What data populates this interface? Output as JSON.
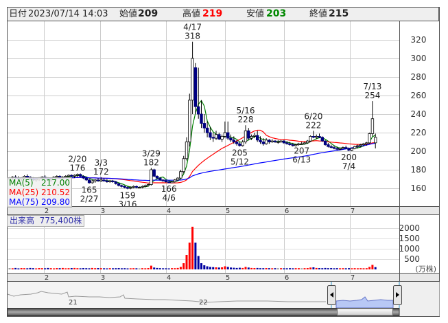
{
  "header": {
    "date_label": "日付",
    "datetime": "2023/07/14 14:03",
    "open_label": "始値",
    "open": "209",
    "high_label": "高値",
    "high": "219",
    "low_label": "安値",
    "low": "203",
    "close_label": "終値",
    "close": "215"
  },
  "colors": {
    "up_volume": "#ff0000",
    "down_volume": "#0000a0",
    "flat_volume": "#909090",
    "down_candle": "#000080",
    "ma5": "#008000",
    "ma25": "#ff0000",
    "ma75": "#0000ff",
    "high_text": "#ff0000",
    "low_text": "#008000"
  },
  "legend": {
    "ma5_label": "MA(5)",
    "ma5_value": "217.00",
    "ma25_label": "MA(25)",
    "ma25_value": "210.52",
    "ma75_label": "MA(75)",
    "ma75_value": "209.80"
  },
  "volume_panel": {
    "label": "出来高",
    "value": "775,400株",
    "unit": "(万株)"
  },
  "navigator": {
    "labels": [
      "21",
      "22"
    ]
  },
  "chart_data": {
    "type": "candlestick",
    "y_ticks": [
      160,
      180,
      200,
      220,
      240,
      260,
      280,
      300,
      320
    ],
    "ylim": [
      150,
      330
    ],
    "month_labels": [
      "2",
      "3",
      "4",
      "5",
      "6",
      "7"
    ],
    "month_start_index": [
      10,
      31,
      53,
      73,
      93,
      115
    ],
    "ohlc": [
      [
        170,
        172,
        168,
        171
      ],
      [
        171,
        173,
        169,
        172
      ],
      [
        172,
        174,
        170,
        171
      ],
      [
        171,
        173,
        169,
        170
      ],
      [
        170,
        172,
        168,
        171
      ],
      [
        171,
        174,
        170,
        173
      ],
      [
        173,
        175,
        171,
        172
      ],
      [
        172,
        173,
        169,
        170
      ],
      [
        170,
        172,
        168,
        169
      ],
      [
        169,
        171,
        167,
        170
      ],
      [
        170,
        172,
        168,
        171
      ],
      [
        171,
        173,
        169,
        172
      ],
      [
        172,
        174,
        170,
        171
      ],
      [
        171,
        172,
        168,
        169
      ],
      [
        169,
        171,
        167,
        170
      ],
      [
        170,
        173,
        169,
        172
      ],
      [
        172,
        174,
        171,
        173
      ],
      [
        173,
        174,
        170,
        171
      ],
      [
        171,
        173,
        170,
        172
      ],
      [
        172,
        174,
        171,
        173
      ],
      [
        173,
        175,
        172,
        174
      ],
      [
        174,
        175,
        172,
        173
      ],
      [
        173,
        175,
        171,
        174
      ],
      [
        174,
        176,
        172,
        175
      ],
      [
        175,
        176,
        172,
        173
      ],
      [
        173,
        174,
        170,
        171
      ],
      [
        171,
        172,
        168,
        169
      ],
      [
        169,
        170,
        165,
        166
      ],
      [
        166,
        169,
        165,
        168
      ],
      [
        168,
        170,
        166,
        169
      ],
      [
        169,
        171,
        167,
        168
      ],
      [
        168,
        172,
        167,
        169
      ],
      [
        169,
        171,
        167,
        168
      ],
      [
        168,
        170,
        166,
        167
      ],
      [
        167,
        169,
        166,
        168
      ],
      [
        168,
        169,
        166,
        167
      ],
      [
        167,
        168,
        164,
        165
      ],
      [
        165,
        166,
        162,
        163
      ],
      [
        163,
        164,
        161,
        162
      ],
      [
        162,
        163,
        160,
        161
      ],
      [
        161,
        162,
        159,
        160
      ],
      [
        160,
        162,
        159,
        161
      ],
      [
        161,
        163,
        160,
        162
      ],
      [
        162,
        163,
        160,
        161
      ],
      [
        161,
        162,
        160,
        161
      ],
      [
        161,
        163,
        160,
        162
      ],
      [
        162,
        164,
        161,
        163
      ],
      [
        163,
        165,
        162,
        164
      ],
      [
        164,
        182,
        163,
        180
      ],
      [
        180,
        181,
        172,
        173
      ],
      [
        173,
        174,
        170,
        171
      ],
      [
        171,
        172,
        168,
        169
      ],
      [
        169,
        170,
        167,
        168
      ],
      [
        168,
        169,
        166,
        167
      ],
      [
        167,
        168,
        166,
        166
      ],
      [
        166,
        168,
        166,
        167
      ],
      [
        167,
        170,
        166,
        169
      ],
      [
        169,
        172,
        168,
        171
      ],
      [
        171,
        180,
        170,
        178
      ],
      [
        178,
        195,
        176,
        192
      ],
      [
        192,
        215,
        190,
        210
      ],
      [
        210,
        262,
        205,
        255
      ],
      [
        255,
        318,
        240,
        300
      ],
      [
        290,
        295,
        240,
        248
      ],
      [
        248,
        290,
        235,
        240
      ],
      [
        240,
        255,
        225,
        230
      ],
      [
        230,
        240,
        220,
        225
      ],
      [
        225,
        232,
        215,
        220
      ],
      [
        220,
        226,
        212,
        215
      ],
      [
        215,
        220,
        210,
        214
      ],
      [
        214,
        222,
        212,
        218
      ],
      [
        218,
        220,
        212,
        213
      ],
      [
        213,
        218,
        210,
        216
      ],
      [
        216,
        232,
        214,
        220
      ],
      [
        220,
        232,
        212,
        214
      ],
      [
        214,
        218,
        210,
        212
      ],
      [
        212,
        216,
        208,
        210
      ],
      [
        210,
        212,
        206,
        208
      ],
      [
        208,
        210,
        205,
        206
      ],
      [
        206,
        212,
        205,
        210
      ],
      [
        210,
        228,
        208,
        222
      ],
      [
        222,
        225,
        212,
        214
      ],
      [
        214,
        218,
        212,
        216
      ],
      [
        216,
        220,
        214,
        217
      ],
      [
        217,
        222,
        210,
        212
      ],
      [
        212,
        216,
        208,
        210
      ],
      [
        210,
        214,
        206,
        208
      ],
      [
        208,
        214,
        207,
        212
      ],
      [
        212,
        213,
        208,
        210
      ],
      [
        210,
        213,
        209,
        211
      ],
      [
        211,
        212,
        209,
        210
      ],
      [
        210,
        212,
        208,
        210
      ],
      [
        210,
        212,
        209,
        211
      ],
      [
        211,
        212,
        208,
        209
      ],
      [
        209,
        211,
        207,
        208
      ],
      [
        208,
        210,
        206,
        207
      ],
      [
        207,
        209,
        205,
        206
      ],
      [
        206,
        208,
        205,
        207
      ],
      [
        207,
        209,
        206,
        208
      ],
      [
        208,
        210,
        207,
        208
      ],
      [
        208,
        210,
        207,
        209
      ],
      [
        209,
        212,
        208,
        211
      ],
      [
        211,
        217,
        210,
        216
      ],
      [
        216,
        222,
        214,
        215
      ],
      [
        215,
        218,
        213,
        216
      ],
      [
        216,
        219,
        214,
        215
      ],
      [
        215,
        216,
        210,
        211
      ],
      [
        211,
        212,
        206,
        207
      ],
      [
        207,
        209,
        204,
        205
      ],
      [
        205,
        207,
        203,
        204
      ],
      [
        204,
        206,
        202,
        203
      ],
      [
        203,
        205,
        201,
        202
      ],
      [
        202,
        204,
        201,
        203
      ],
      [
        203,
        205,
        202,
        204
      ],
      [
        204,
        206,
        202,
        203
      ],
      [
        203,
        204,
        200,
        201
      ],
      [
        201,
        204,
        200,
        203
      ],
      [
        203,
        206,
        202,
        205
      ],
      [
        205,
        207,
        203,
        206
      ],
      [
        206,
        208,
        204,
        207
      ],
      [
        207,
        209,
        205,
        208
      ],
      [
        208,
        210,
        206,
        209
      ],
      [
        209,
        220,
        208,
        219
      ],
      [
        219,
        254,
        216,
        235
      ],
      [
        209,
        219,
        203,
        215
      ]
    ],
    "volume": [
      60,
      55,
      70,
      50,
      65,
      60,
      55,
      70,
      60,
      50,
      65,
      60,
      55,
      70,
      60,
      50,
      65,
      60,
      70,
      55,
      60,
      65,
      70,
      60,
      55,
      65,
      60,
      55,
      70,
      60,
      65,
      60,
      55,
      50,
      60,
      55,
      60,
      65,
      55,
      60,
      50,
      55,
      60,
      55,
      50,
      60,
      55,
      65,
      180,
      90,
      70,
      60,
      55,
      55,
      50,
      60,
      60,
      70,
      120,
      300,
      700,
      1300,
      2070,
      1300,
      650,
      300,
      200,
      150,
      120,
      110,
      100,
      90,
      100,
      150,
      120,
      90,
      80,
      70,
      80,
      70,
      120,
      90,
      70,
      65,
      70,
      60,
      60,
      65,
      60,
      55,
      60,
      55,
      60,
      55,
      55,
      60,
      55,
      60,
      60,
      55,
      60,
      65,
      90,
      100,
      70,
      65,
      60,
      70,
      60,
      65,
      55,
      60,
      55,
      60,
      55,
      60,
      55,
      60,
      55,
      60,
      55,
      60,
      120,
      220,
      110
    ],
    "volume_ticks": [
      500,
      1000,
      1500,
      2000
    ],
    "annotations": [
      {
        "date": "2/20",
        "value": "176",
        "pos": "above",
        "index": 23,
        "price": 176
      },
      {
        "date": "3/3",
        "value": "172",
        "pos": "above",
        "index": 31,
        "price": 172
      },
      {
        "date": "3/29",
        "value": "182",
        "pos": "above",
        "index": 48,
        "price": 182
      },
      {
        "date": "4/17",
        "value": "318",
        "pos": "above",
        "index": 62,
        "price": 318
      },
      {
        "date": "5/16",
        "value": "228",
        "pos": "above",
        "index": 80,
        "price": 228
      },
      {
        "date": "6/20",
        "value": "222",
        "pos": "above",
        "index": 103,
        "price": 222
      },
      {
        "date": "7/13",
        "value": "254",
        "pos": "above",
        "index": 123,
        "price": 254
      },
      {
        "date": "2/27",
        "value": "165",
        "pos": "below",
        "index": 27,
        "price": 165
      },
      {
        "date": "3/16",
        "value": "159",
        "pos": "below",
        "index": 40,
        "price": 159
      },
      {
        "date": "4/6",
        "value": "166",
        "pos": "below",
        "index": 54,
        "price": 166
      },
      {
        "date": "5/12",
        "value": "205",
        "pos": "below",
        "index": 78,
        "price": 205
      },
      {
        "date": "6/13",
        "value": "207",
        "pos": "below",
        "index": 99,
        "price": 207
      },
      {
        "date": "7/4",
        "value": "200",
        "pos": "below",
        "index": 115,
        "price": 200
      }
    ]
  }
}
